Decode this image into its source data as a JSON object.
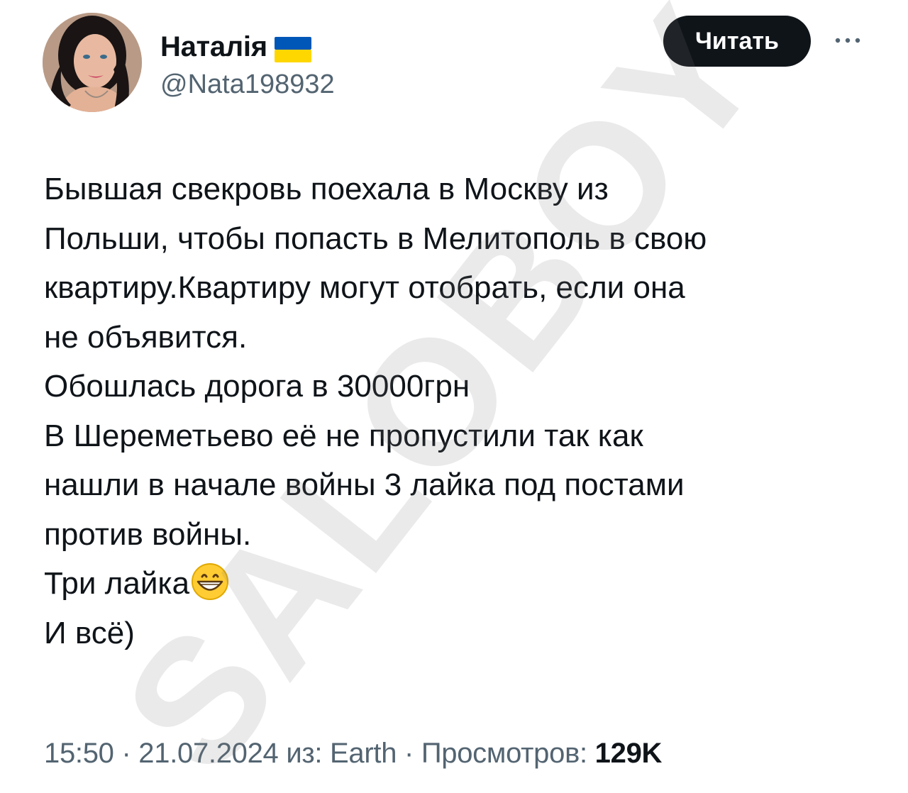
{
  "author": {
    "name": "Наталія",
    "handle": "@Nata198932",
    "avatar_icon": "profile-photo",
    "flag_icon": "ukraine-flag-icon"
  },
  "actions": {
    "follow_label": "Читать",
    "more_icon": "more-dots-icon"
  },
  "tweet": {
    "lines": [
      "Бывшая свекровь поехала в Москву из",
      "Польши, чтобы попасть в Мелитополь в свою",
      "квартиру.Квартиру могут отобрать, если она",
      "не объявится.",
      "Обошлась дорога в 30000грн",
      "В Шереметьево её не пропустили так как",
      "нашли в начале войны 3 лайка под постами",
      "против войны.",
      "Три лайка",
      "И всё)"
    ],
    "emoji": "grinning-face-icon"
  },
  "meta": {
    "time": "15:50",
    "separator": "·",
    "date": "21.07.2024",
    "source": "из: Earth",
    "views_label": "Просмотров:",
    "views_count": "129K"
  },
  "watermark": {
    "text": "SALOBOY"
  },
  "colors": {
    "text": "#0f1419",
    "secondary": "#536471",
    "button_bg": "#0f1419",
    "flag_blue": "#0057b7",
    "flag_yellow": "#ffd700"
  }
}
